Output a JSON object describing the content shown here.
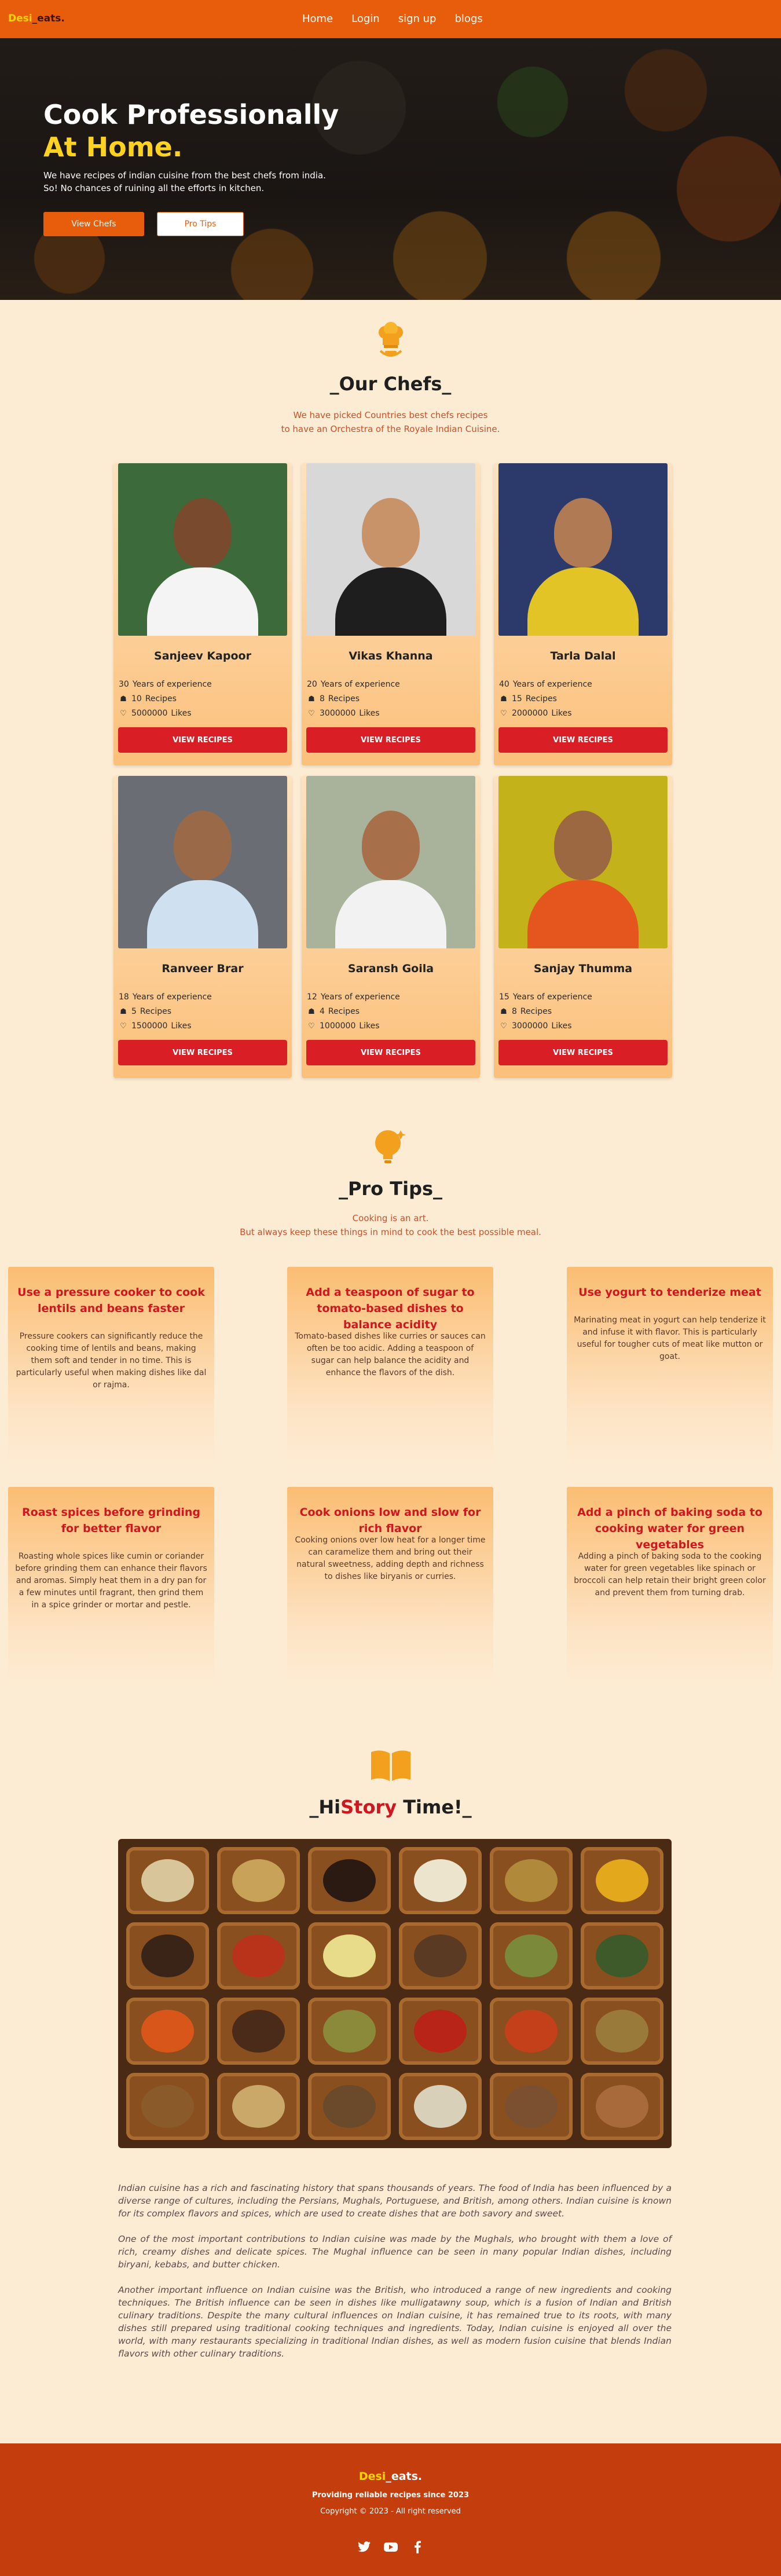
{
  "brand": {
    "part1": "Desi",
    "part2": "_eats."
  },
  "nav": {
    "items": [
      "Home",
      "Login",
      "sign up",
      "blogs"
    ]
  },
  "hero": {
    "title_line1": "Cook Professionally",
    "title_line2": "At Home.",
    "subtitle_line1": "We have recipes of indian cuisine from the best chefs from india.",
    "subtitle_line2": "So! No chances of ruining all the efforts in kitchen.",
    "btn_chefs": "View Chefs",
    "btn_tips": "Pro Tips"
  },
  "chefs_section": {
    "icon": "chef-hat-icon",
    "title": "_Our Chefs_",
    "subtitle_line1": "We have picked Countries best chefs recipes",
    "subtitle_line2": "to have an Orchestra of the Royale Indian Cuisine.",
    "years_label": "Years of experience",
    "recipes_label": "Recipes",
    "likes_label": "Likes",
    "button_label": "VIEW RECIPES",
    "chefs": [
      {
        "name": "Sanjeev Kapoor",
        "years": "30",
        "recipes": "10",
        "likes": "5000000"
      },
      {
        "name": "Vikas Khanna",
        "years": "20",
        "recipes": "8",
        "likes": "3000000"
      },
      {
        "name": "Tarla Dalal",
        "years": "40",
        "recipes": "15",
        "likes": "2000000"
      },
      {
        "name": "Ranveer Brar",
        "years": "18",
        "recipes": "5",
        "likes": "1500000"
      },
      {
        "name": "Saransh Goila",
        "years": "12",
        "recipes": "4",
        "likes": "1000000"
      },
      {
        "name": "Sanjay Thumma",
        "years": "15",
        "recipes": "8",
        "likes": "3000000"
      }
    ]
  },
  "tips_section": {
    "icon": "lightbulb-icon",
    "title": "_Pro Tips_",
    "subtitle_line1": "Cooking is an art.",
    "subtitle_line2": "But always keep these things in mind to cook the best possible meal.",
    "tips": [
      {
        "title": "Use a pressure cooker to cook lentils and beans faster",
        "text": "Pressure cookers can significantly reduce the cooking time of lentils and beans, making them soft and tender in no time. This is particularly useful when making dishes like dal or rajma."
      },
      {
        "title": "Add a teaspoon of sugar to tomato-based dishes to balance acidity",
        "text": "Tomato-based dishes like curries or sauces can often be too acidic. Adding a teaspoon of sugar can help balance the acidity and enhance the flavors of the dish."
      },
      {
        "title": "Use yogurt to tenderize meat",
        "text": "Marinating meat in yogurt can help tenderize it and infuse it with flavor. This is particularly useful for tougher cuts of meat like mutton or goat."
      },
      {
        "title": "Roast spices before grinding for better flavor",
        "text": "Roasting whole spices like cumin or coriander before grinding them can enhance their flavors and aromas. Simply heat them in a dry pan for a few minutes until fragrant, then grind them in a spice grinder or mortar and pestle."
      },
      {
        "title": "Cook onions low and slow for rich flavor",
        "text": "Cooking onions over low heat for a longer time can caramelize them and bring out their natural sweetness, adding depth and richness to dishes like biryanis or curries."
      },
      {
        "title": "Add a pinch of baking soda to cooking water for green vegetables",
        "text": "Adding a pinch of baking soda to the cooking water for green vegetables like spinach or broccoli can help retain their bright green color and prevent them from turning drab."
      }
    ]
  },
  "history_section": {
    "icon": "book-icon",
    "title_a": "_Hi",
    "title_b": "Story",
    "title_c": " Time!_",
    "paragraphs": [
      "Indian cuisine has a rich and fascinating history that spans thousands of years. The food of India has been influenced by a diverse range of cultures, including the Persians, Mughals, Portuguese, and British, among others. Indian cuisine is known for its complex flavors and spices, which are used to create dishes that are both savory and sweet.",
      "One of the most important contributions to Indian cuisine was made by the Mughals, who brought with them a love of rich, creamy dishes and delicate spices. The Mughal influence can be seen in many popular Indian dishes, including biryani, kebabs, and butter chicken.",
      "Another important influence on Indian cuisine was the British, who introduced a range of new ingredients and cooking techniques. The British influence can be seen in dishes like mulligatawny soup, which is a fusion of Indian and British culinary traditions. Despite the many cultural influences on Indian cuisine, it has remained true to its roots, with many dishes still prepared using traditional cooking techniques and ingredients. Today, Indian cuisine is enjoyed all over the world, with many restaurants specializing in traditional Indian dishes, as well as modern fusion cuisine that blends Indian flavors with other culinary traditions."
    ]
  },
  "footer": {
    "brand_part1": "Desi",
    "brand_part2": "_eats.",
    "tagline": "Providing reliable recipes since 2023",
    "copyright": "Copyright © 2023 - All right reserved",
    "socials": [
      "twitter-icon",
      "youtube-icon",
      "facebook-icon"
    ]
  },
  "colors": {
    "primary": "#e85d0c",
    "accent_yellow": "#ffd21f",
    "red": "#d91e26",
    "background": "#fdecd4",
    "footer": "#c43d0d"
  }
}
